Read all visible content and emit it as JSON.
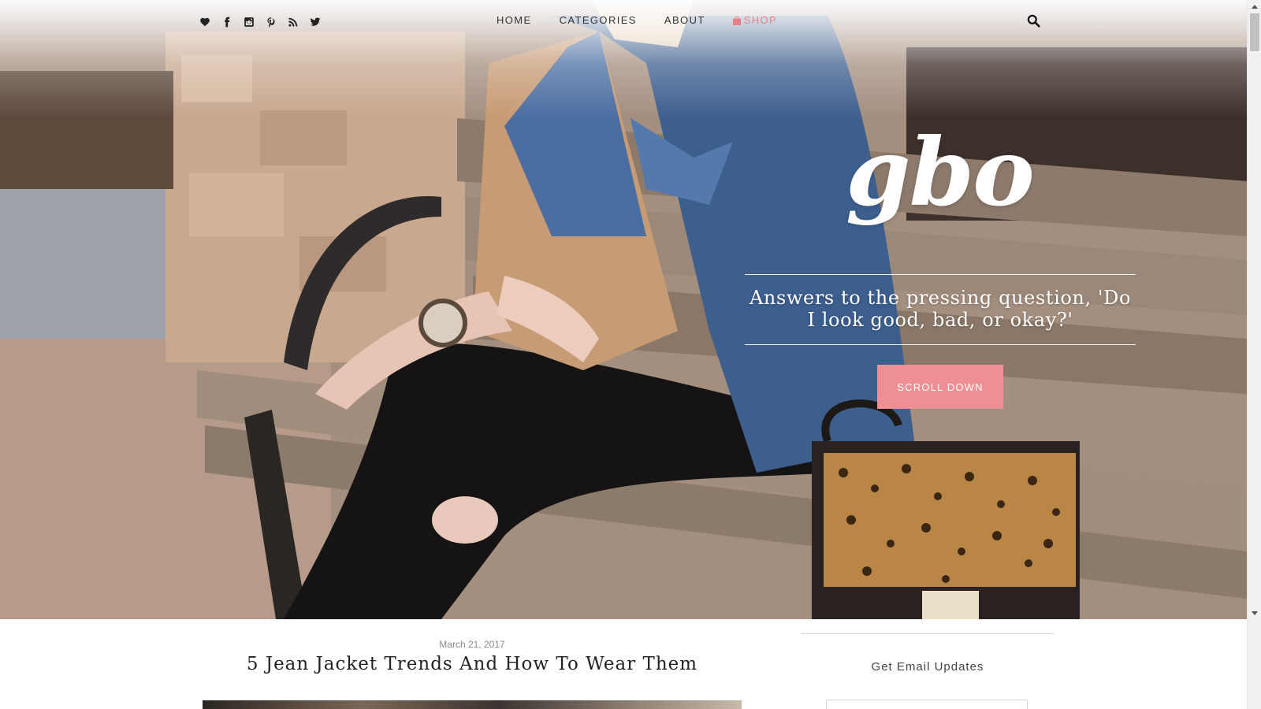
{
  "social_icons": [
    "heart-icon",
    "facebook-icon",
    "instagram-icon",
    "pinterest-icon",
    "rss-icon",
    "twitter-icon"
  ],
  "nav": {
    "home": "HOME",
    "categories": "CATEGORIES",
    "about": "ABOUT",
    "shop": "SHOP"
  },
  "hero": {
    "logo": "gbo",
    "tagline": "Answers to the pressing question, 'Do I look good, bad, or okay?'",
    "scroll_button": "SCROLL DOWN"
  },
  "post": {
    "date": "March 21, 2017",
    "title": "5 Jean Jacket Trends And How To Wear Them"
  },
  "sidebar": {
    "email_title": "Get Email Updates"
  },
  "colors": {
    "accent": "#ef8e93",
    "shop_link": "#ec7f86",
    "text_dark": "#222222"
  }
}
